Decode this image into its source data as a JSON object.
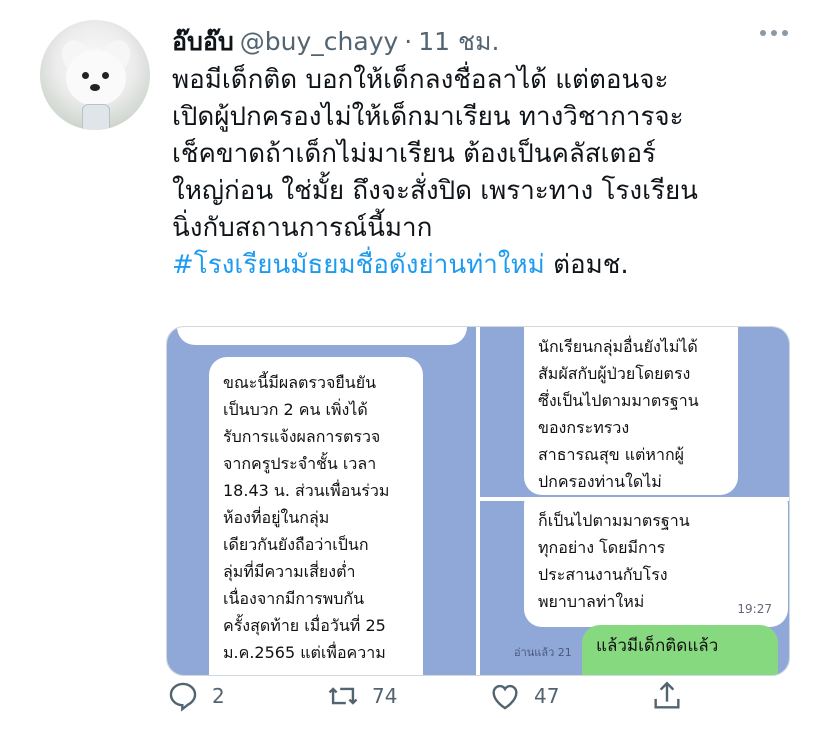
{
  "tweet": {
    "display_name": "อ๊บอ๊บ",
    "handle": "@buy_chayy",
    "separator": "·",
    "time": "11 ชม.",
    "text_lines": [
      "พอมีเด็กติด บอกให้เด็กลงชื่อลาได้ แต่ตอนจะ",
      "เปิดผู้ปกครองไม่ให้เด็กมาเรียน ทางวิชาการจะ",
      "เช็คขาดถ้าเด็กไม่มาเรียน ต้องเป็นคลัสเตอร์",
      "ใหญ่ก่อน ใช่มั้ย ถึงจะสั่งปิด เพราะทาง โรงเรียน",
      "นิ่งกับสถานการณ์นี้มาก"
    ],
    "hashtag": "#โรงเรียนมัธยมชื่อดังย่านท่าใหม่",
    "text_suffix": " ต่อมช."
  },
  "media": {
    "panel1_lines": [
      "ขณะนี้มีผลตรวจยืนยัน",
      "เป็นบวก 2 คน  เพิ่งได้",
      "รับการแจ้งผลการตรวจ",
      "จากครูประจำชั้น  เวลา",
      "18.43 น. ส่วนเพื่อนร่วม",
      "ห้องที่อยู่ในกลุ่ม",
      "เดียวกันยังถือว่าเป็นก",
      "ลุ่มที่มีความเสี่ยงต่ำ",
      "เนื่องจากมีการพบกัน",
      "ครั้งสุดท้าย เมื่อวันที่ 25",
      "ม.ค.2565 แต่เพื่อความ"
    ],
    "panel2_lines": [
      "นักเรียนกลุ่มอื่นยังไม่ได้",
      "สัมผัสกับผู้ป่วยโดยตรง",
      "ซึ่งเป็นไปตามมาตรฐาน",
      "ของกระทรวง",
      "สาธารณสุข  แต่หากผู้",
      "ปกครองท่านใดไม่"
    ],
    "panel3_lines": [
      "ก็เป็นไปตามมาตรฐาน",
      "ทุกอย่าง  โดยมีการ",
      "ประสานงานกับโรง",
      "พยาบาลท่าใหม่"
    ],
    "panel3_time": "19:27",
    "reply_line": "แล้วมีเด็กติดแล้ว",
    "read_label": "อ่านแล้ว 21"
  },
  "actions": {
    "replies": "2",
    "retweets": "74",
    "likes": "47"
  },
  "colors": {
    "hashtag": "#1d9bf0",
    "muted": "#536471",
    "chat_bg": "#8fa8d8",
    "reply_bubble": "#86d97f"
  },
  "icons": [
    "more-icon",
    "reply-icon",
    "retweet-icon",
    "like-icon",
    "share-icon"
  ]
}
